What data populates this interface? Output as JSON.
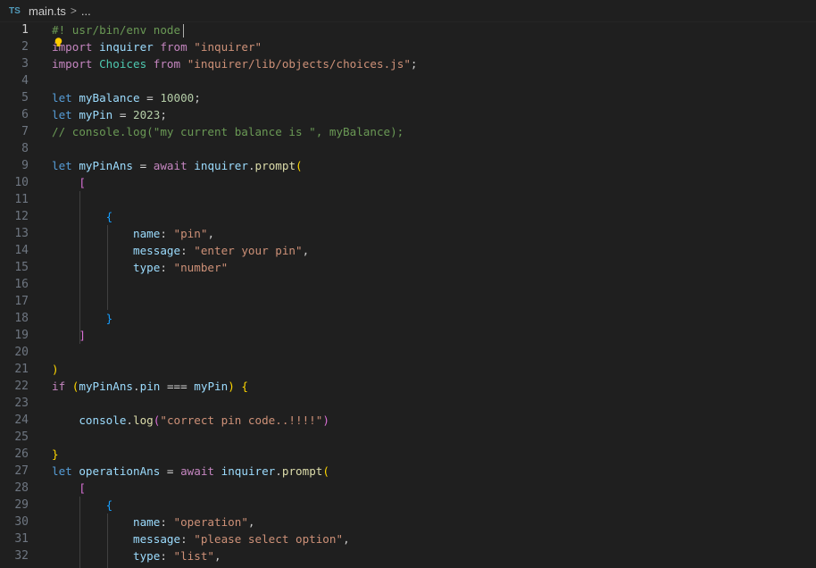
{
  "breadcrumb": {
    "lang_badge": "TS",
    "file": "main.ts",
    "separator": ">",
    "more": "..."
  },
  "editor": {
    "active_line": 1,
    "lines": [
      {
        "n": "1",
        "tokens": [
          {
            "t": "#! usr/bin/env node",
            "c": "cmt"
          }
        ]
      },
      {
        "n": "2",
        "tokens": [
          {
            "t": "import",
            "c": "kw"
          },
          {
            "t": " "
          },
          {
            "t": "inquirer",
            "c": "var"
          },
          {
            "t": " "
          },
          {
            "t": "from",
            "c": "kw"
          },
          {
            "t": " "
          },
          {
            "t": "\"inquirer\"",
            "c": "str"
          }
        ]
      },
      {
        "n": "3",
        "tokens": [
          {
            "t": "import",
            "c": "kw"
          },
          {
            "t": " "
          },
          {
            "t": "Choices",
            "c": "type"
          },
          {
            "t": " "
          },
          {
            "t": "from",
            "c": "kw"
          },
          {
            "t": " "
          },
          {
            "t": "\"inquirer/lib/objects/choices.js\"",
            "c": "str"
          },
          {
            "t": ";"
          }
        ]
      },
      {
        "n": "4",
        "tokens": []
      },
      {
        "n": "5",
        "tokens": [
          {
            "t": "let",
            "c": "dec"
          },
          {
            "t": " "
          },
          {
            "t": "myBalance",
            "c": "var"
          },
          {
            "t": " = ",
            "c": "op"
          },
          {
            "t": "10000",
            "c": "num"
          },
          {
            "t": ";"
          }
        ]
      },
      {
        "n": "6",
        "tokens": [
          {
            "t": "let",
            "c": "dec"
          },
          {
            "t": " "
          },
          {
            "t": "myPin",
            "c": "var"
          },
          {
            "t": " = ",
            "c": "op"
          },
          {
            "t": "2023",
            "c": "num"
          },
          {
            "t": ";"
          }
        ]
      },
      {
        "n": "7",
        "tokens": [
          {
            "t": "// console.log(\"my current balance is \", myBalance);",
            "c": "cmt"
          }
        ]
      },
      {
        "n": "8",
        "tokens": []
      },
      {
        "n": "9",
        "tokens": [
          {
            "t": "let",
            "c": "dec"
          },
          {
            "t": " "
          },
          {
            "t": "myPinAns",
            "c": "var"
          },
          {
            "t": " = ",
            "c": "op"
          },
          {
            "t": "await",
            "c": "kw"
          },
          {
            "t": " "
          },
          {
            "t": "inquirer",
            "c": "var"
          },
          {
            "t": "."
          },
          {
            "t": "prompt",
            "c": "fn"
          },
          {
            "t": "(",
            "c": "p1"
          }
        ]
      },
      {
        "n": "10",
        "tokens": [
          {
            "t": "    "
          },
          {
            "t": "[",
            "c": "p2"
          }
        ]
      },
      {
        "n": "11",
        "tokens": []
      },
      {
        "n": "12",
        "tokens": [
          {
            "t": "        "
          },
          {
            "t": "{",
            "c": "p3"
          }
        ]
      },
      {
        "n": "13",
        "tokens": [
          {
            "t": "            "
          },
          {
            "t": "name",
            "c": "var"
          },
          {
            "t": ": "
          },
          {
            "t": "\"pin\"",
            "c": "str"
          },
          {
            "t": ","
          }
        ]
      },
      {
        "n": "14",
        "tokens": [
          {
            "t": "            "
          },
          {
            "t": "message",
            "c": "var"
          },
          {
            "t": ": "
          },
          {
            "t": "\"enter your pin\"",
            "c": "str"
          },
          {
            "t": ","
          }
        ]
      },
      {
        "n": "15",
        "tokens": [
          {
            "t": "            "
          },
          {
            "t": "type",
            "c": "var"
          },
          {
            "t": ": "
          },
          {
            "t": "\"number\"",
            "c": "str"
          }
        ]
      },
      {
        "n": "16",
        "tokens": []
      },
      {
        "n": "17",
        "tokens": []
      },
      {
        "n": "18",
        "tokens": [
          {
            "t": "        "
          },
          {
            "t": "}",
            "c": "p3"
          }
        ]
      },
      {
        "n": "19",
        "tokens": [
          {
            "t": "    "
          },
          {
            "t": "]",
            "c": "p2"
          }
        ]
      },
      {
        "n": "20",
        "tokens": []
      },
      {
        "n": "21",
        "tokens": [
          {
            "t": ")",
            "c": "p1"
          }
        ]
      },
      {
        "n": "22",
        "tokens": [
          {
            "t": "if",
            "c": "kw"
          },
          {
            "t": " "
          },
          {
            "t": "(",
            "c": "p1"
          },
          {
            "t": "myPinAns",
            "c": "var"
          },
          {
            "t": "."
          },
          {
            "t": "pin",
            "c": "var"
          },
          {
            "t": " === ",
            "c": "op"
          },
          {
            "t": "myPin",
            "c": "var"
          },
          {
            "t": ")",
            "c": "p1"
          },
          {
            "t": " "
          },
          {
            "t": "{",
            "c": "p1"
          }
        ]
      },
      {
        "n": "23",
        "tokens": []
      },
      {
        "n": "24",
        "tokens": [
          {
            "t": "    "
          },
          {
            "t": "console",
            "c": "var"
          },
          {
            "t": "."
          },
          {
            "t": "log",
            "c": "fn"
          },
          {
            "t": "(",
            "c": "p2"
          },
          {
            "t": "\"correct pin code..!!!!\"",
            "c": "str"
          },
          {
            "t": ")",
            "c": "p2"
          }
        ]
      },
      {
        "n": "25",
        "tokens": []
      },
      {
        "n": "26",
        "tokens": [
          {
            "t": "}",
            "c": "p1"
          }
        ]
      },
      {
        "n": "27",
        "tokens": [
          {
            "t": "let",
            "c": "dec"
          },
          {
            "t": " "
          },
          {
            "t": "operationAns",
            "c": "var"
          },
          {
            "t": " = ",
            "c": "op"
          },
          {
            "t": "await",
            "c": "kw"
          },
          {
            "t": " "
          },
          {
            "t": "inquirer",
            "c": "var"
          },
          {
            "t": "."
          },
          {
            "t": "prompt",
            "c": "fn"
          },
          {
            "t": "(",
            "c": "p1"
          }
        ]
      },
      {
        "n": "28",
        "tokens": [
          {
            "t": "    "
          },
          {
            "t": "[",
            "c": "p2"
          }
        ]
      },
      {
        "n": "29",
        "tokens": [
          {
            "t": "        "
          },
          {
            "t": "{",
            "c": "p3"
          }
        ]
      },
      {
        "n": "30",
        "tokens": [
          {
            "t": "            "
          },
          {
            "t": "name",
            "c": "var"
          },
          {
            "t": ": "
          },
          {
            "t": "\"operation\"",
            "c": "str"
          },
          {
            "t": ","
          }
        ]
      },
      {
        "n": "31",
        "tokens": [
          {
            "t": "            "
          },
          {
            "t": "message",
            "c": "var"
          },
          {
            "t": ": "
          },
          {
            "t": "\"please select option\"",
            "c": "str"
          },
          {
            "t": ","
          }
        ]
      },
      {
        "n": "32",
        "tokens": [
          {
            "t": "            "
          },
          {
            "t": "type",
            "c": "var"
          },
          {
            "t": ": "
          },
          {
            "t": "\"list\"",
            "c": "str"
          },
          {
            "t": ","
          }
        ]
      }
    ]
  }
}
